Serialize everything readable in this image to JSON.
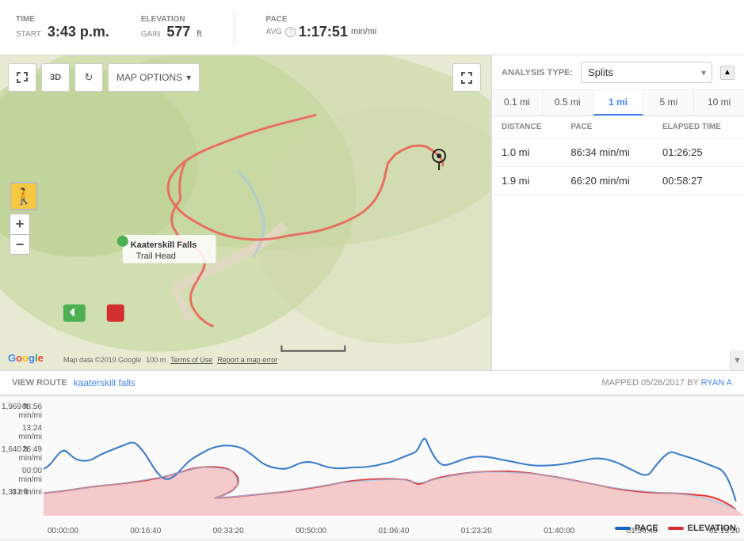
{
  "top_bar": {
    "time_label": "TIME",
    "start_label": "START",
    "start_value": "3:43 p.m.",
    "elevation_label": "ELEVATION",
    "gain_label": "GAIN",
    "gain_value": "577",
    "gain_unit": "ft",
    "pace_label": "PACE",
    "avg_label": "AVG",
    "pace_value": "1:17:51",
    "pace_unit": "min/mi"
  },
  "map": {
    "options_btn": "MAP OPTIONS",
    "location_label": "Kaaterskill Falls\nTrail Head",
    "attribution": "Map data ©2019 Google",
    "scale": "100 m",
    "terms": "Terms of Use",
    "report": "Report a map error"
  },
  "analysis": {
    "type_label": "ANALYSIS TYPE:",
    "selected": "Splits",
    "scroll_up": "▲",
    "scroll_down": "▼",
    "distance_tabs": [
      "0.1 mi",
      "0.5 mi",
      "1 mi",
      "5 mi",
      "10 mi"
    ],
    "active_tab": "1 mi",
    "table": {
      "headers": [
        "DISTANCE",
        "PACE",
        "ELAPSED TIME"
      ],
      "rows": [
        {
          "distance": "1.0 mi",
          "pace": "86:34 min/mi",
          "elapsed": "01:26:25"
        },
        {
          "distance": "1.9 mi",
          "pace": "66:20 min/mi",
          "elapsed": "00:58:27"
        }
      ]
    }
  },
  "view_route": {
    "label": "VIEW ROUTE",
    "route_name": "kaaterskill falls",
    "mapped_label": "MAPPED",
    "mapped_date": "05/26/2017",
    "by_label": "BY",
    "by_name": "RYAN A"
  },
  "chart": {
    "elev_labels": [
      "1,969 ft",
      "1,640 ft",
      "1,312 ft"
    ],
    "pace_labels": [
      "08:56 min/mi",
      "13:24 min/mi",
      "26:49 min/mi",
      "00:00 min/mi",
      "0 min/mi"
    ],
    "x_labels": [
      "00:00:00",
      "00:16:40",
      "00:33:20",
      "00:50:00",
      "01:06:40",
      "01:23:20",
      "01:40:00",
      "01:56:40",
      "02:13:20"
    ],
    "legend": {
      "pace_label": "PACE",
      "pace_color": "#2979FF",
      "elevation_label": "ELEVATION",
      "elevation_color": "#D32F2F"
    }
  }
}
